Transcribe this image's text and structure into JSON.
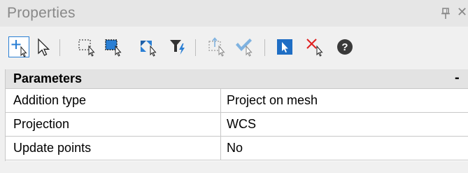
{
  "panel": {
    "title": "Properties",
    "pin_icon": "pin-icon",
    "close_glyph": "✕"
  },
  "toolbar": {
    "buttons": [
      {
        "name": "add-point-tool",
        "icon": "plus-cursor-icon",
        "active": true
      },
      {
        "name": "select-tool",
        "icon": "arrow-cursor-icon",
        "active": false
      },
      {
        "name": "rect-select-tool",
        "icon": "dashed-rect-cursor-icon",
        "active": false
      },
      {
        "name": "region-select-tool",
        "icon": "filled-rect-cursor-icon",
        "active": false
      },
      {
        "name": "transform-tool",
        "icon": "arrows-cursor-icon",
        "active": false
      },
      {
        "name": "filter-tool",
        "icon": "funnel-lightning-icon",
        "active": false
      },
      {
        "name": "move-points-tool",
        "icon": "dashed-arrow-cursor-icon",
        "active": false
      },
      {
        "name": "confirm-tool",
        "icon": "check-cursor-icon",
        "active": false
      },
      {
        "name": "pick-tool",
        "icon": "blue-cursor-icon",
        "active": false
      },
      {
        "name": "delete-tool",
        "icon": "red-x-cursor-icon",
        "active": false
      },
      {
        "name": "help-button",
        "icon": "help-circle-icon",
        "label": "?",
        "active": false
      }
    ]
  },
  "grid": {
    "group": {
      "label": "Parameters",
      "toggle": "-"
    },
    "rows": [
      {
        "name": "Addition type",
        "value": "Project on mesh"
      },
      {
        "name": "Projection",
        "value": "WCS"
      },
      {
        "name": "Update points",
        "value": "No"
      }
    ]
  },
  "colors": {
    "accent": "#2a7fd4",
    "check": "#7fb2e0",
    "delete": "#e02020",
    "filter_bolt": "#2a7fd4"
  }
}
